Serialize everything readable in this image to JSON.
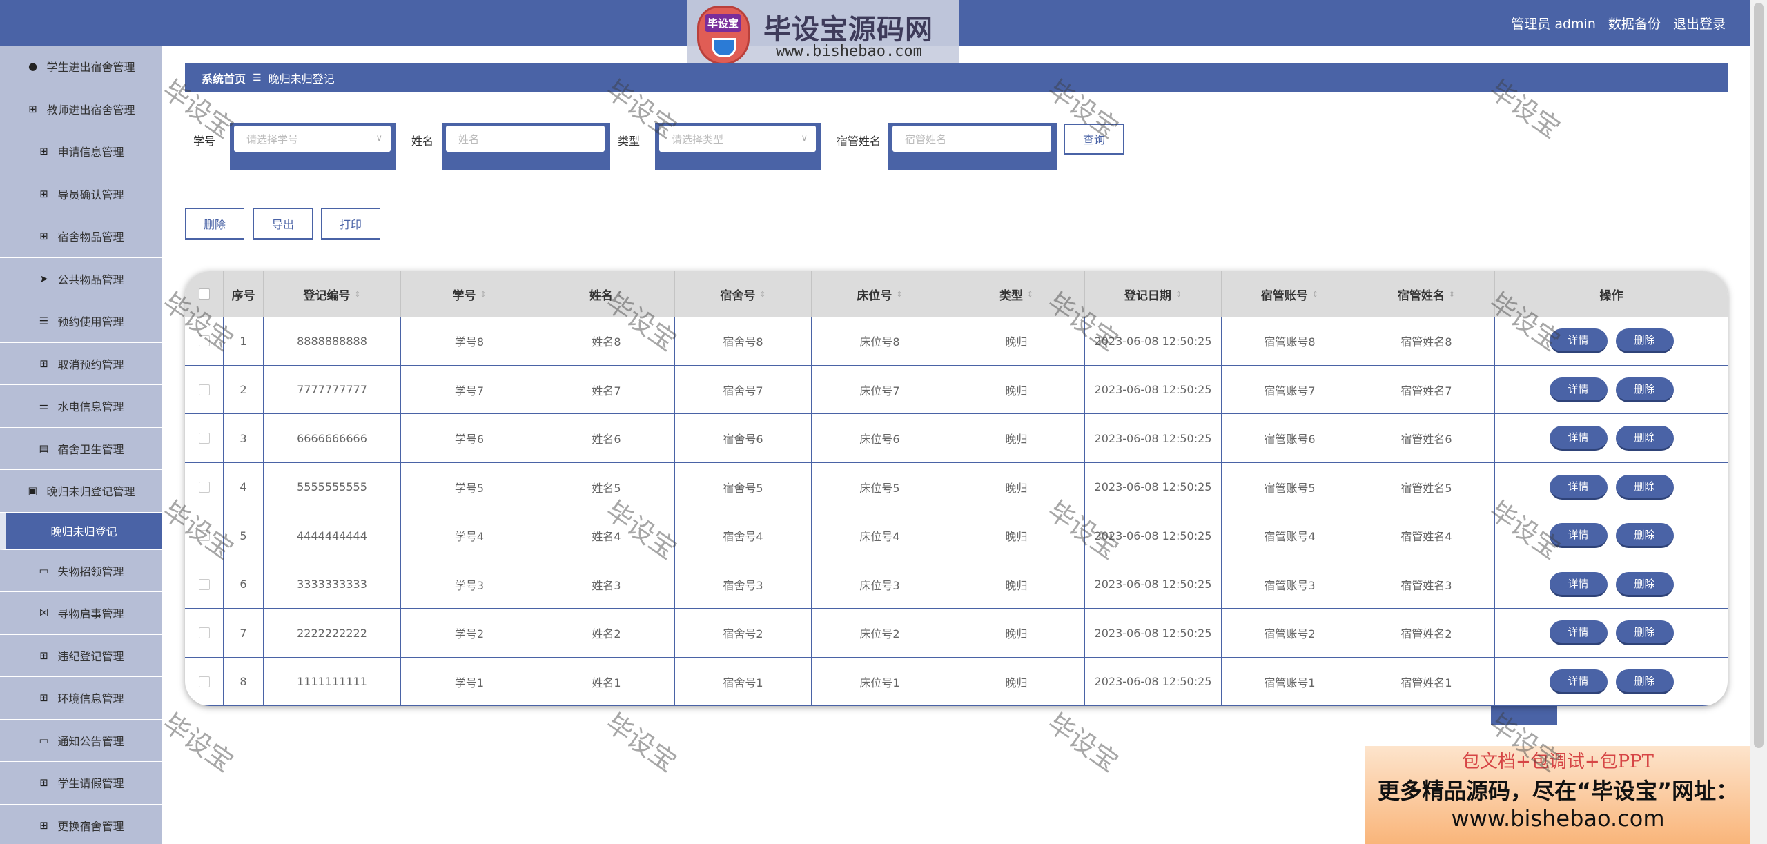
{
  "header": {
    "user_label": "管理员 admin",
    "backup_label": "数据备份",
    "logout_label": "退出登录",
    "logo_badge": "毕设宝",
    "logo_title": "毕设宝源码网",
    "logo_url": "www.bishebao.com"
  },
  "sidebar": {
    "items": [
      {
        "label": "学生进出宿舍管理",
        "icon": "user-icon"
      },
      {
        "label": "教师进出宿舍管理",
        "icon": "grid-icon"
      },
      {
        "label": "申请信息管理",
        "icon": "grid-icon"
      },
      {
        "label": "导员确认管理",
        "icon": "grid-icon"
      },
      {
        "label": "宿舍物品管理",
        "icon": "grid-icon"
      },
      {
        "label": "公共物品管理",
        "icon": "send-icon"
      },
      {
        "label": "预约使用管理",
        "icon": "list-icon"
      },
      {
        "label": "取消预约管理",
        "icon": "grid-icon"
      },
      {
        "label": "水电信息管理",
        "icon": "sliders-icon"
      },
      {
        "label": "宿舍卫生管理",
        "icon": "clipboard-icon"
      },
      {
        "label": "晚归未归登记管理",
        "icon": "chat-icon"
      },
      {
        "label": "晚归未归登记",
        "icon": "",
        "active": true
      },
      {
        "label": "失物招领管理",
        "icon": "card-icon"
      },
      {
        "label": "寻物启事管理",
        "icon": "x-box-icon"
      },
      {
        "label": "违纪登记管理",
        "icon": "grid-icon"
      },
      {
        "label": "环境信息管理",
        "icon": "grid-icon"
      },
      {
        "label": "通知公告管理",
        "icon": "monitor-icon"
      },
      {
        "label": "学生请假管理",
        "icon": "grid-icon"
      },
      {
        "label": "更换宿舍管理",
        "icon": "grid-icon"
      }
    ]
  },
  "breadcrumb": {
    "home": "系统首页",
    "separator": "☰",
    "current": "晚归未归登记"
  },
  "search": {
    "student_id_label": "学号",
    "student_id_placeholder": "请选择学号",
    "name_label": "姓名",
    "name_placeholder": "姓名",
    "type_label": "类型",
    "type_placeholder": "请选择类型",
    "manager_label": "宿管姓名",
    "manager_placeholder": "宿管姓名",
    "query_label": "查询"
  },
  "actions": {
    "delete_label": "删除",
    "export_label": "导出",
    "print_label": "打印"
  },
  "table": {
    "columns": [
      "序号",
      "登记编号",
      "学号",
      "姓名",
      "宿舍号",
      "床位号",
      "类型",
      "登记日期",
      "宿管账号",
      "宿管姓名",
      "操作"
    ],
    "detail_label": "详情",
    "delete_label": "删除",
    "rows": [
      {
        "idx": "1",
        "code": "8888888888",
        "sid": "学号8",
        "name": "姓名8",
        "dorm": "宿舍号8",
        "bed": "床位号8",
        "type": "晚归",
        "date": "2023-06-08 12:50:25",
        "acct": "宿管账号8",
        "mgr": "宿管姓名8"
      },
      {
        "idx": "2",
        "code": "7777777777",
        "sid": "学号7",
        "name": "姓名7",
        "dorm": "宿舍号7",
        "bed": "床位号7",
        "type": "晚归",
        "date": "2023-06-08 12:50:25",
        "acct": "宿管账号7",
        "mgr": "宿管姓名7"
      },
      {
        "idx": "3",
        "code": "6666666666",
        "sid": "学号6",
        "name": "姓名6",
        "dorm": "宿舍号6",
        "bed": "床位号6",
        "type": "晚归",
        "date": "2023-06-08 12:50:25",
        "acct": "宿管账号6",
        "mgr": "宿管姓名6"
      },
      {
        "idx": "4",
        "code": "5555555555",
        "sid": "学号5",
        "name": "姓名5",
        "dorm": "宿舍号5",
        "bed": "床位号5",
        "type": "晚归",
        "date": "2023-06-08 12:50:25",
        "acct": "宿管账号5",
        "mgr": "宿管姓名5"
      },
      {
        "idx": "5",
        "code": "4444444444",
        "sid": "学号4",
        "name": "姓名4",
        "dorm": "宿舍号4",
        "bed": "床位号4",
        "type": "晚归",
        "date": "2023-06-08 12:50:25",
        "acct": "宿管账号4",
        "mgr": "宿管姓名4"
      },
      {
        "idx": "6",
        "code": "3333333333",
        "sid": "学号3",
        "name": "姓名3",
        "dorm": "宿舍号3",
        "bed": "床位号3",
        "type": "晚归",
        "date": "2023-06-08 12:50:25",
        "acct": "宿管账号3",
        "mgr": "宿管姓名3"
      },
      {
        "idx": "7",
        "code": "2222222222",
        "sid": "学号2",
        "name": "姓名2",
        "dorm": "宿舍号2",
        "bed": "床位号2",
        "type": "晚归",
        "date": "2023-06-08 12:50:25",
        "acct": "宿管账号2",
        "mgr": "宿管姓名2"
      },
      {
        "idx": "8",
        "code": "1111111111",
        "sid": "学号1",
        "name": "姓名1",
        "dorm": "宿舍号1",
        "bed": "床位号1",
        "type": "晚归",
        "date": "2023-06-08 12:50:25",
        "acct": "宿管账号1",
        "mgr": "宿管姓名1"
      }
    ]
  },
  "promo": {
    "line1": "包文档+包调试+包PPT",
    "line2": "更多精品源码，尽在“毕设宝”网址：",
    "line3": "www.bishebao.com"
  },
  "watermark": "毕设宝",
  "colors": {
    "accent": "#4a63a6",
    "sidebar": "#b6bed6",
    "header_row": "#dcdcdc"
  }
}
